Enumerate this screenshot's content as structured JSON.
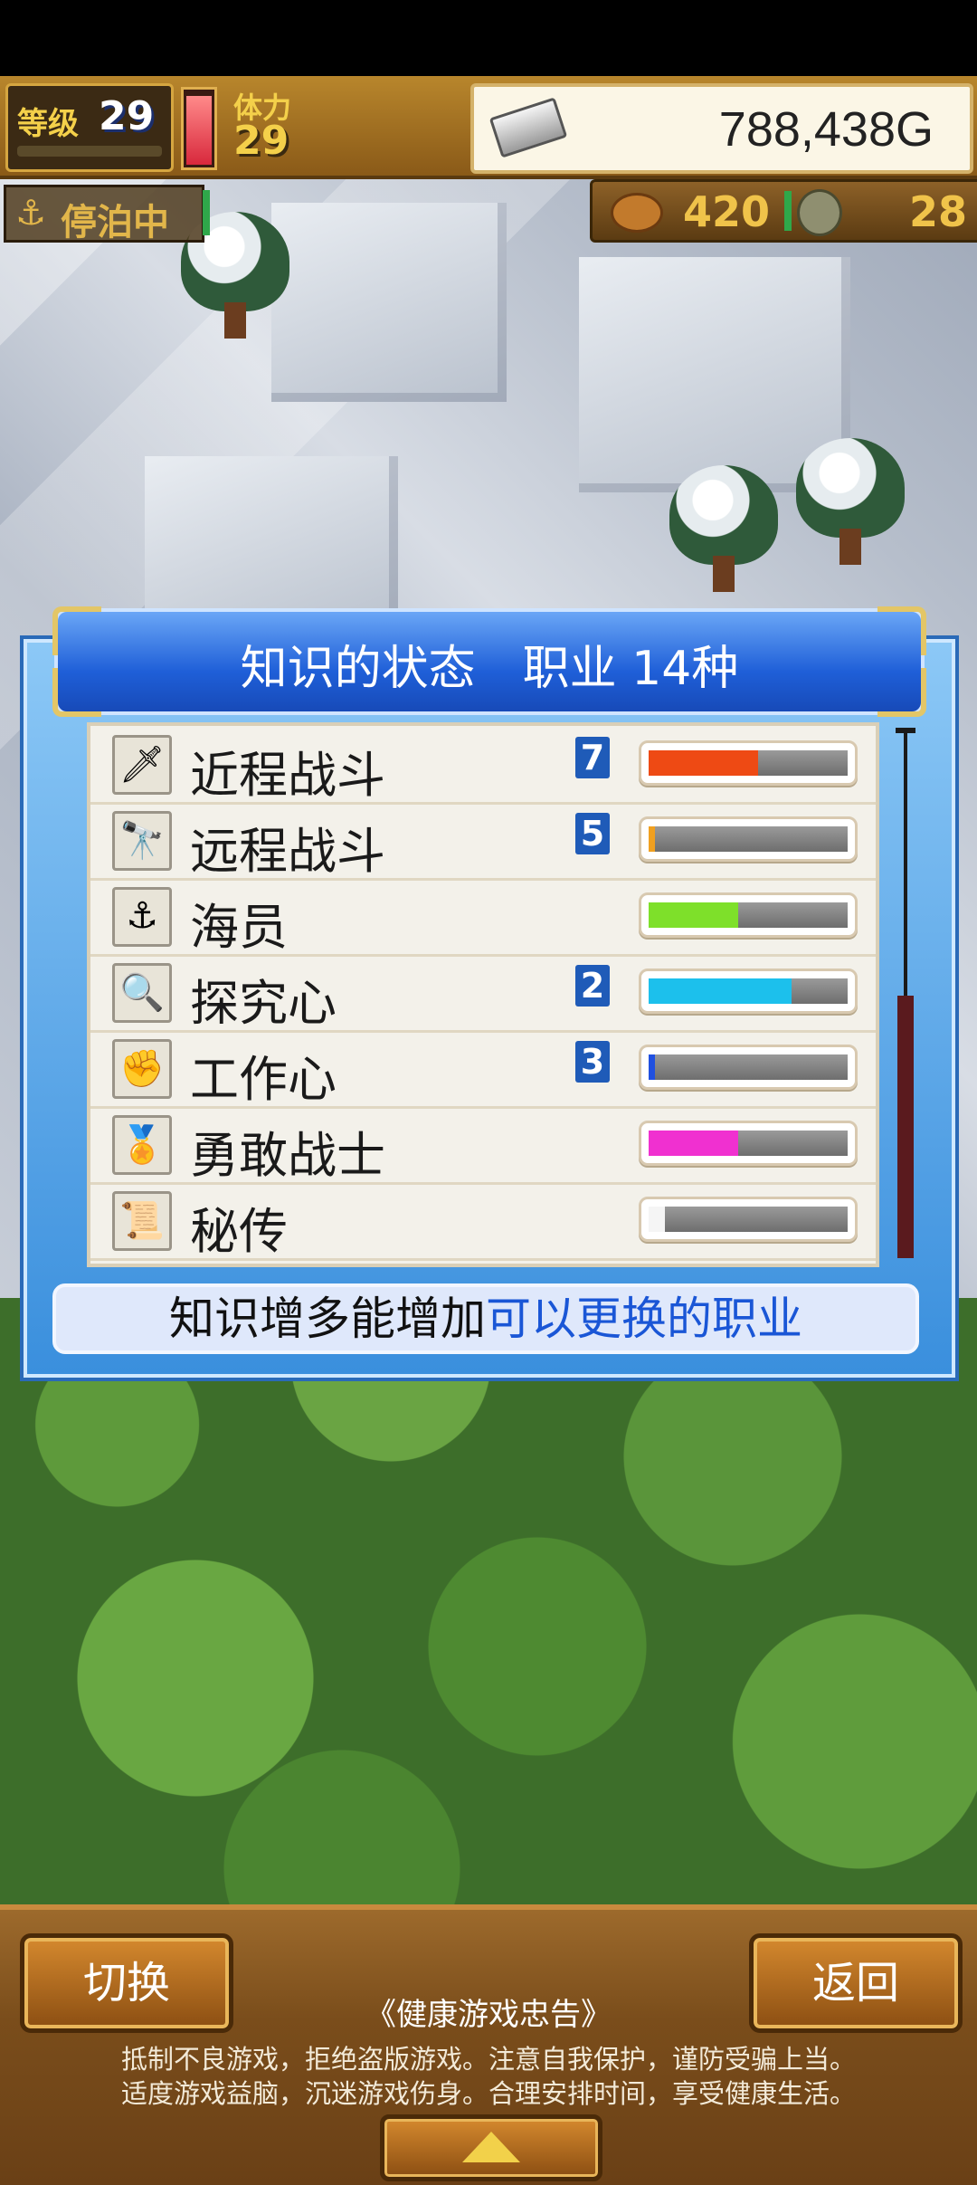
{
  "hud": {
    "level_label": "等级",
    "level_value": "29",
    "stamina_label": "体力",
    "stamina_value": "29",
    "stamina_fill": 0.95,
    "gold_value": "788,438G",
    "dock_status": "停泊中",
    "dock_icon": "anchor-icon",
    "food_value": "420",
    "crew_value": "28"
  },
  "panel": {
    "title": "知识的状态　职业 14种",
    "rows": [
      {
        "name": "近程战斗",
        "rank": "7",
        "progress": 0.55,
        "color": "#ee4a14",
        "icon": "sword-icon",
        "glyph": "🗡"
      },
      {
        "name": "远程战斗",
        "rank": "5",
        "progress": 0.02,
        "color": "#f0a020",
        "icon": "telescope-icon",
        "glyph": "🔭"
      },
      {
        "name": "海员",
        "rank": "",
        "progress": 0.45,
        "color": "#7ee02a",
        "icon": "anchor-icon",
        "glyph": "⚓"
      },
      {
        "name": "探究心",
        "rank": "2",
        "progress": 0.72,
        "color": "#1cc0ec",
        "icon": "magnifier-icon",
        "glyph": "🔍"
      },
      {
        "name": "工作心",
        "rank": "3",
        "progress": 0.03,
        "color": "#2050e0",
        "icon": "fist-icon",
        "glyph": "✊"
      },
      {
        "name": "勇敢战士",
        "rank": "",
        "progress": 0.45,
        "color": "#f030d0",
        "icon": "medal-icon",
        "glyph": "🏅"
      },
      {
        "name": "秘传",
        "rank": "",
        "progress": 0.08,
        "color": "#f5f5f5",
        "icon": "scroll-icon",
        "glyph": "📜"
      }
    ],
    "scroll_position": 0.33,
    "hint_black": "知识增多能增加",
    "hint_blue": "可以更换的职业"
  },
  "bottom": {
    "switch_label": "切换",
    "back_label": "返回",
    "notice_title": "《健康游戏忠告》",
    "notice_line1": "抵制不良游戏，拒绝盗版游戏。注意自我保护，谨防受骗上当。",
    "notice_line2": "适度游戏益脑，沉迷游戏伤身。合理安排时间，享受健康生活。"
  }
}
